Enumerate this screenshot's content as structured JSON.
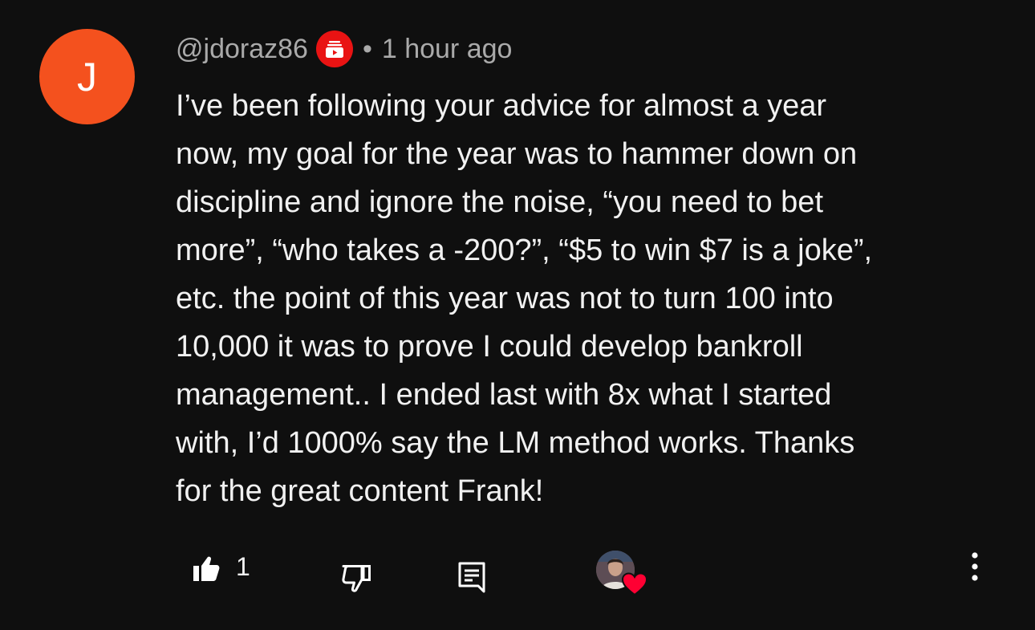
{
  "comment": {
    "avatar_letter": "J",
    "username": "@jdoraz86",
    "separator": "•",
    "timestamp": "1 hour ago",
    "badge_icon": "membership-badge-icon",
    "text": "I’ve been following your advice for almost a year\nnow, my goal for the year was to hammer down on\ndiscipline and ignore the noise, “you need to bet\nmore”, “who takes a -200?”, “$5 to win $7 is a joke”,\netc. the point of this year was not to turn 100 into\n10,000 it was to prove I could develop bankroll\nmanagement.. I ended last with 8x what I started\nwith, I’d 1000% say the LM method works.  Thanks\nfor the great content Frank!"
  },
  "actions": {
    "like_count": "1",
    "like_icon": "thumbs-up-icon",
    "dislike_icon": "thumbs-down-icon",
    "reply_icon": "reply-icon",
    "creator_heart_icon": "heart-icon",
    "more_icon": "more-vert-icon"
  },
  "colors": {
    "background": "#0f0f0f",
    "avatar": "#f4511e",
    "badge": "#e91313",
    "heart": "#ff0033",
    "text": "#f1f1f1",
    "secondary_text": "#aaaaaa"
  }
}
